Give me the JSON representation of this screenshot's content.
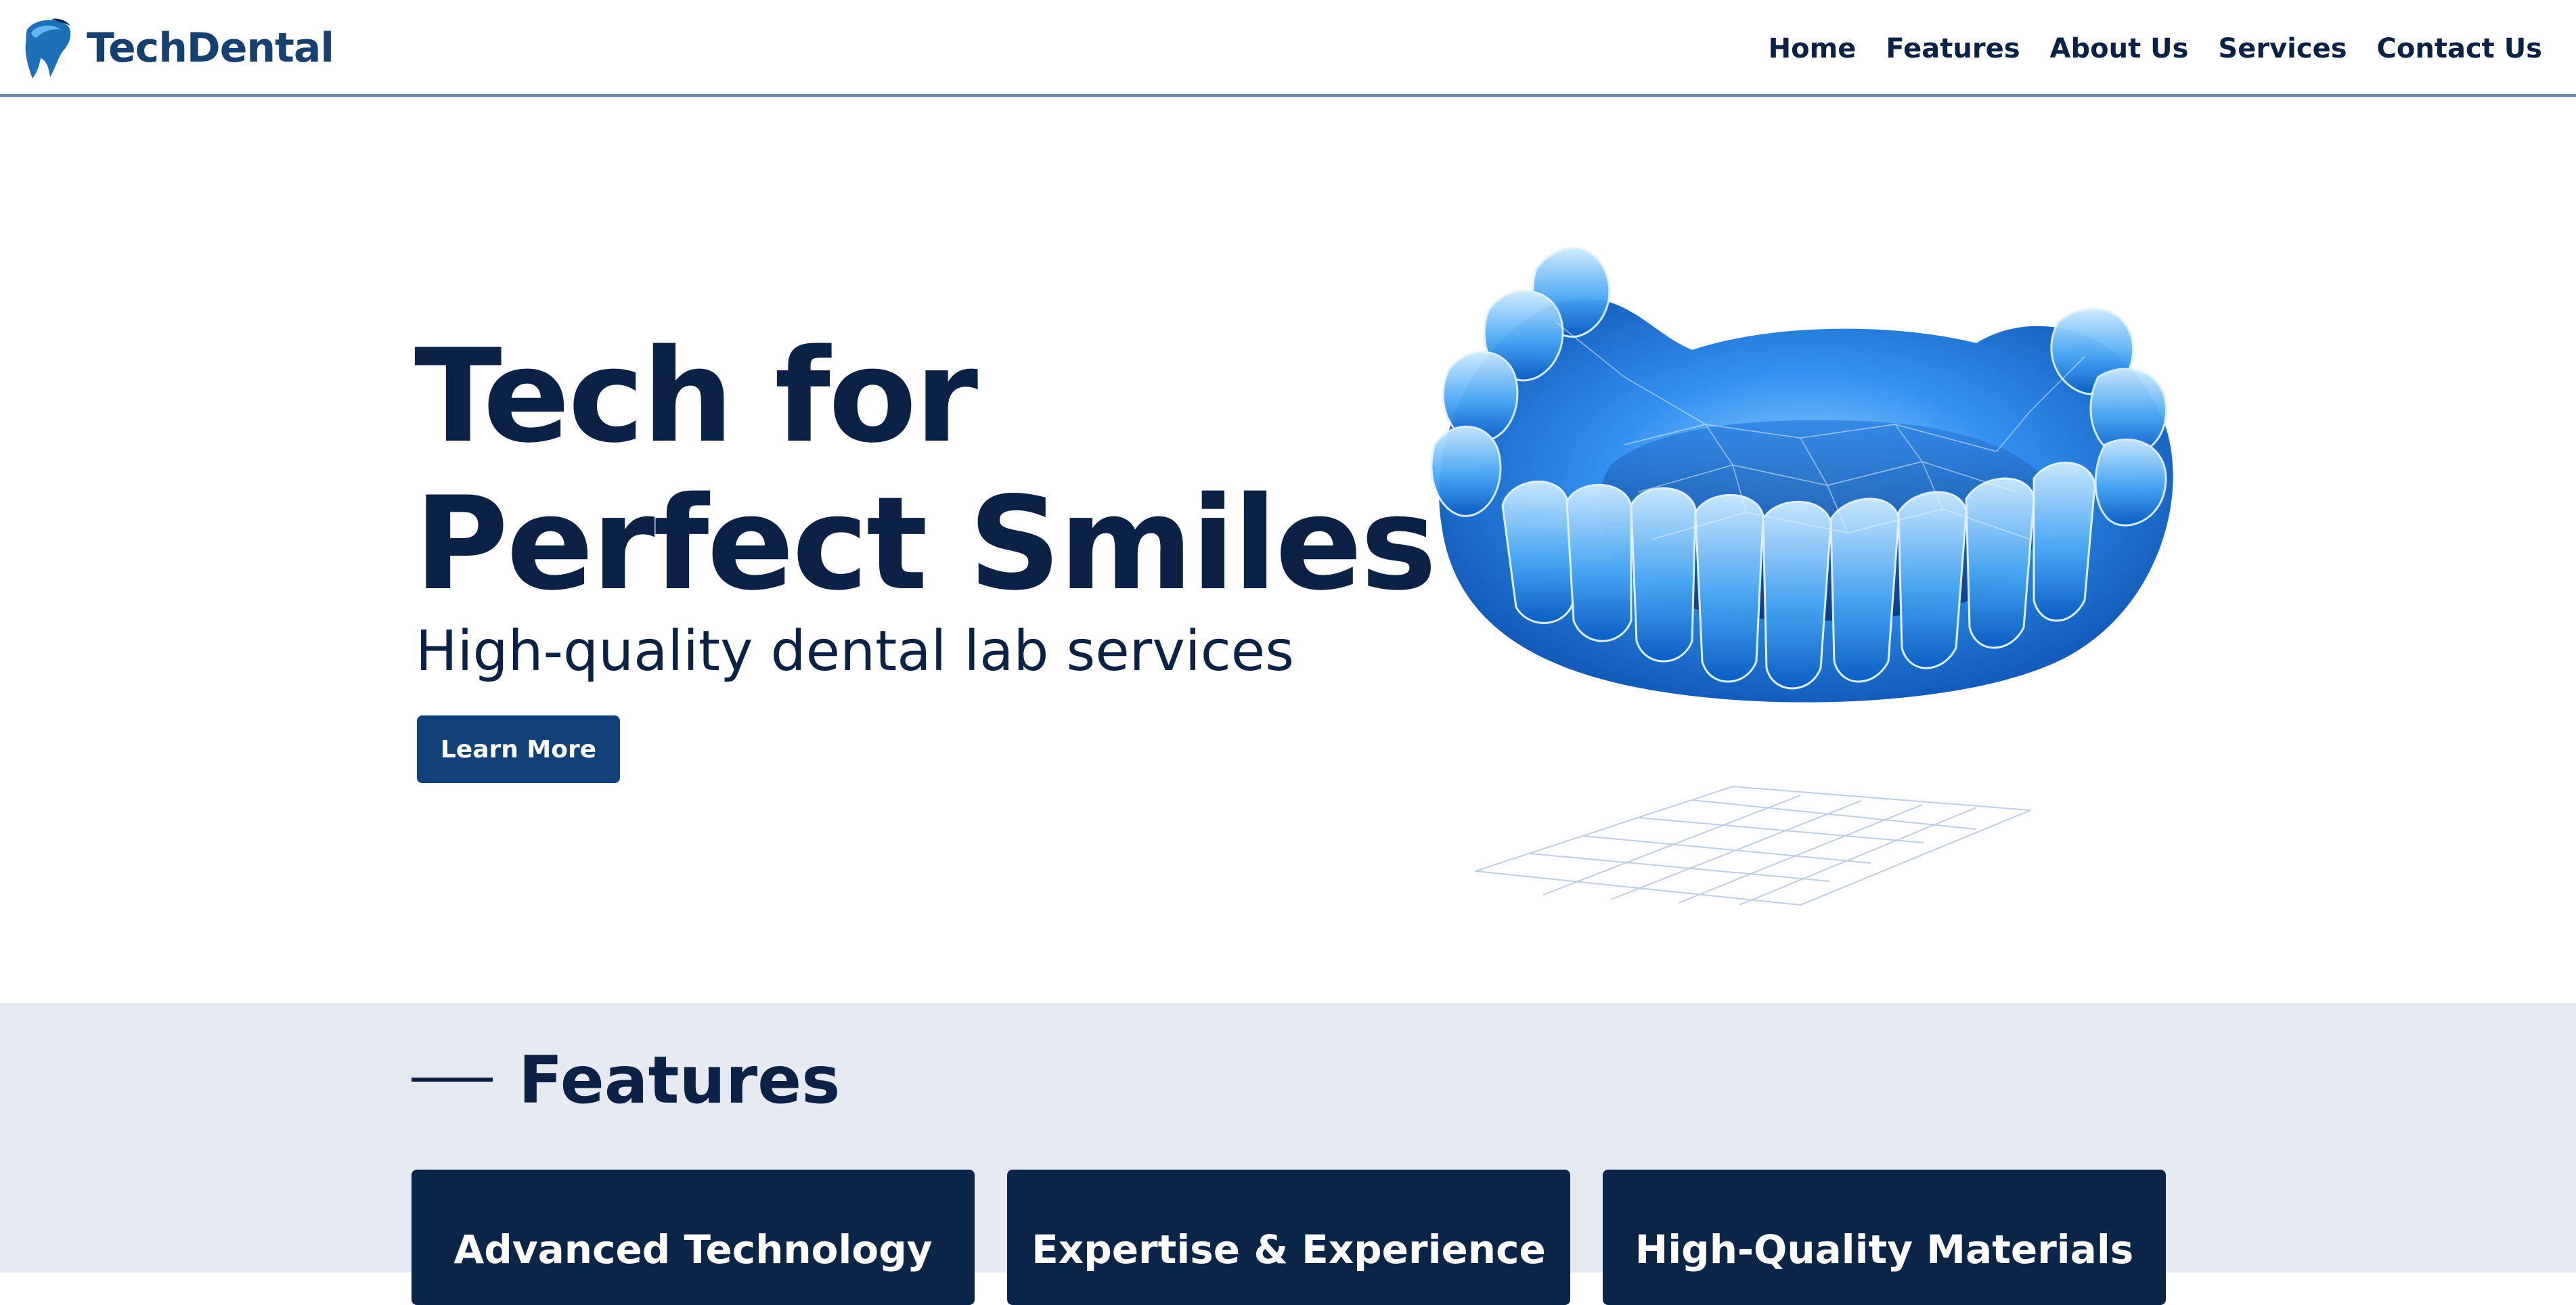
{
  "brand": {
    "name": "TechDental",
    "logo_icon": "tooth-logo-icon"
  },
  "nav": {
    "items": [
      {
        "label": "Home"
      },
      {
        "label": "Features"
      },
      {
        "label": "About Us"
      },
      {
        "label": "Services"
      },
      {
        "label": "Contact Us"
      }
    ]
  },
  "hero": {
    "title_line1": "Tech for",
    "title_line2": "Perfect Smiles",
    "subtitle": "High-quality dental lab services",
    "button_label": "Learn More",
    "image_icon": "3d-dental-model-image"
  },
  "features": {
    "heading": "Features",
    "cards": [
      {
        "title": "Advanced Technology"
      },
      {
        "title": "Expertise & Experience"
      },
      {
        "title": "High-Quality Materials"
      }
    ]
  },
  "colors": {
    "navy": "#0b2146",
    "brand_blue": "#16406f",
    "button_blue": "#144079",
    "features_bg": "#e6ebf3",
    "card_bg": "#0b2549",
    "accent_light_blue": "#3aa0ff"
  }
}
